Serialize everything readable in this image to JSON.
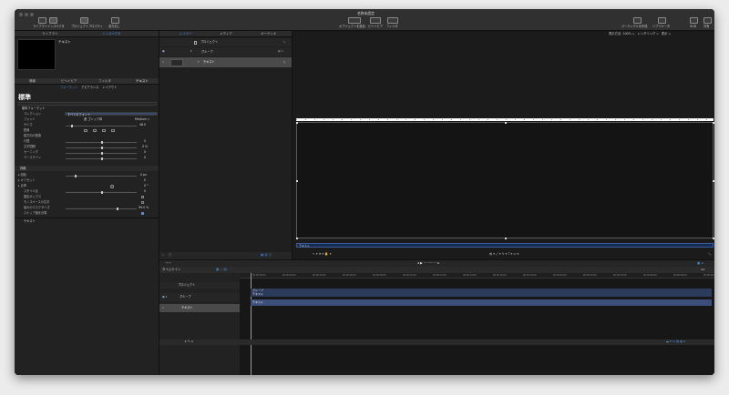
{
  "window": {
    "title": "名称未設定"
  },
  "toolbar": {
    "library": "ライブラリ",
    "inspector": "インスペクタ",
    "project_props": "プロジェクトプロパティ",
    "share": "書き出し",
    "add_object": "オブジェクトを追加",
    "behaviors": "ビヘイビア",
    "filters": "フィルタ",
    "particles": "パーティクルを作成",
    "replicate": "リプリケータ",
    "hud": "HUD",
    "share_right": "共有"
  },
  "left_panel": {
    "tabs": [
      "ライブラリ",
      "インスペクタ"
    ],
    "active_tab": "インスペクタ",
    "preview_title": "テキスト",
    "inspector_tabs": [
      "情報",
      "ビヘイビア",
      "フィルタ",
      "テキスト"
    ],
    "active_inspector_tab": "テキスト",
    "sub_tabs": [
      "フォーマット",
      "アピアランス",
      "レイアウト"
    ],
    "active_sub_tab": "フォーマット",
    "preset": "標準",
    "format_header": "基本フォーマット",
    "rows": [
      {
        "label": "コレクション",
        "value": "すべてのフォント"
      },
      {
        "label": "フォント",
        "value": "遊 ゴシック体",
        "value2": "Medium ◇"
      },
      {
        "label": "サイズ",
        "value": "48.0"
      },
      {
        "label": "配置",
        "value": ""
      },
      {
        "label": "縦方向の配置",
        "value": ""
      },
      {
        "label": "行間",
        "value": "0"
      },
      {
        "label": "文字間隔",
        "value": "0 %"
      },
      {
        "label": "カーニング",
        "value": "0"
      },
      {
        "label": "ベースライン",
        "value": "0"
      }
    ],
    "section2": "詳細",
    "rows2": [
      {
        "label": "▸ 回転",
        "value": "0 px"
      },
      {
        "label": "▸ オフセット",
        "value": "0"
      },
      {
        "label": "▸ 比率",
        "value": "0 °"
      },
      {
        "label": "スタイル比",
        "value": "0"
      },
      {
        "label": "固定ボックス",
        "value": ""
      },
      {
        "label": "モノスペースの文字",
        "value": ""
      },
      {
        "label": "最大のマスクサイズ",
        "value": "99.0 %"
      },
      {
        "label": "スナップ値を計算",
        "value": ""
      }
    ],
    "footer": "テキスト"
  },
  "layers_panel": {
    "tabs": [
      "レイヤー",
      "メディア",
      "オーディオ"
    ],
    "active_tab": "レイヤー",
    "items": [
      {
        "name": "プロジェクト"
      },
      {
        "name": "グループ"
      },
      {
        "name": "テキスト"
      }
    ]
  },
  "canvas": {
    "zoom": "表示方法: 100% ◇",
    "render": "レンダリング ◇",
    "view": "表示 ◇",
    "caption": "テキスト"
  },
  "timeline": {
    "title": "タイムライン",
    "layers": [
      {
        "name": "プロジェクト"
      },
      {
        "name": "グループ"
      },
      {
        "name": "テキスト"
      }
    ],
    "tracks": [
      {
        "label": "グループ"
      },
      {
        "label": "テキスト"
      },
      {
        "label": "テキスト"
      }
    ],
    "ruler_marks": [
      "00:00:00:00",
      "00:00:02:00",
      "00:00:04:00",
      "00:00:06:00",
      "00:00:08:00",
      "00:00:10:00",
      "00:00:12:00",
      "00:00:14:00",
      "00:00:16:00",
      "00:00:18:00",
      "00:00:20:00",
      "00:00:22:00",
      "00:00:24:00",
      "00:00:26:00",
      "00:00:28:00",
      "00:00:30:00"
    ],
    "animation_label": "アニメーション"
  },
  "colors": {
    "accent": "#4d8fe0",
    "track": "#3b4f7a",
    "bg": "#1e1e1e"
  }
}
